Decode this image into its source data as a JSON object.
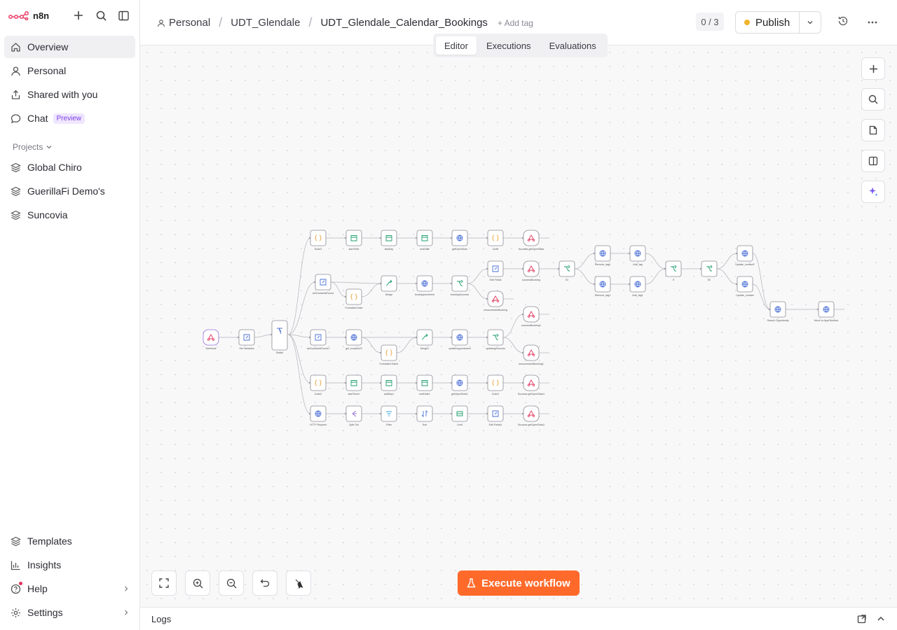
{
  "app": {
    "name": "n8n"
  },
  "sidebar": {
    "items": [
      {
        "label": "Overview",
        "icon": "home-icon"
      },
      {
        "label": "Personal",
        "icon": "user-icon"
      },
      {
        "label": "Shared with you",
        "icon": "share-icon"
      },
      {
        "label": "Chat",
        "icon": "chat-icon",
        "badge": "Preview"
      }
    ],
    "projects_label": "Projects",
    "projects": [
      {
        "label": "Global Chiro"
      },
      {
        "label": "GuerillaFi Demo's"
      },
      {
        "label": "Suncovia"
      }
    ],
    "bottom": [
      {
        "label": "Templates"
      },
      {
        "label": "Insights"
      },
      {
        "label": "Help"
      },
      {
        "label": "Settings"
      }
    ]
  },
  "header": {
    "breadcrumb": [
      "Personal",
      "UDT_Glendale",
      "UDT_Glendale_Calendar_Bookings"
    ],
    "add_tag": "+ Add tag",
    "counter": "0 / 3",
    "publish": "Publish",
    "tabs": [
      "Editor",
      "Executions",
      "Evaluations"
    ]
  },
  "canvas": {
    "execute_label": "Execute workflow",
    "nodes": {
      "webhook": "Webhook",
      "set_vars": "Set Variables",
      "switch": "Switch",
      "code3": "Code3",
      "start_time": "startTime",
      "add_day": "addDay",
      "end_date": "endDate",
      "get_open_slots": "getOpenSlots",
      "code": "Code",
      "success_open_slots": "Success getOpenSlots",
      "set_contact_found": "setContactIdFound",
      "formatted_date": "Formatted Date",
      "merge": "Merge",
      "book_appointment": "bookAppointment",
      "booking_success": "bookingSuccess",
      "edit_fields": "Edit Fields",
      "success_booking": "successBooking",
      "unsuccessful_booking": "unsuccessfulBooking",
      "if_b": "If1",
      "remove_tags": "Remove_tags",
      "remove_tags1": "Remove_tag1",
      "add_tag": "Add_tag",
      "add_tag1": "Add_tag1",
      "if_c": "If",
      "if_d": "If2",
      "update_contact2": "Update_contact2",
      "update_contact": "Update_contact",
      "search_opportunity": "Search Opportunity",
      "move_to_appt": "Move to Appt Booked",
      "set_contact_found1": "setContactIdFound1",
      "get_location": "get_location23",
      "formatted_date1": "Formatted Date1",
      "merge1": "Merge1",
      "update_appointment": "updateAppointment",
      "updating_success": "updatingSuccess",
      "success_booking1": "successBooking1",
      "unsuccessful_booking1": "unsuccessfulBooking1",
      "code2": "Code2",
      "start_time1": "startTime1",
      "add_day1": "addDay1",
      "end_date1": "endDate1",
      "get_open_slots1": "getOpenSlots1",
      "code1": "Code1",
      "success_open_slots1": "Success getOpenSlots1",
      "http_request": "HTTP Request",
      "split_out": "Split Out",
      "filter": "Filter",
      "sort": "Sort",
      "limit": "Limit",
      "edit_fields1": "Edit Fields1",
      "success_open_slots2": "Success getOpenSlots2"
    }
  },
  "logs": {
    "label": "Logs"
  },
  "colors": {
    "accent": "#ff6a2b",
    "publish_dot": "#f2b42c",
    "badge": "#7b3fe4"
  }
}
